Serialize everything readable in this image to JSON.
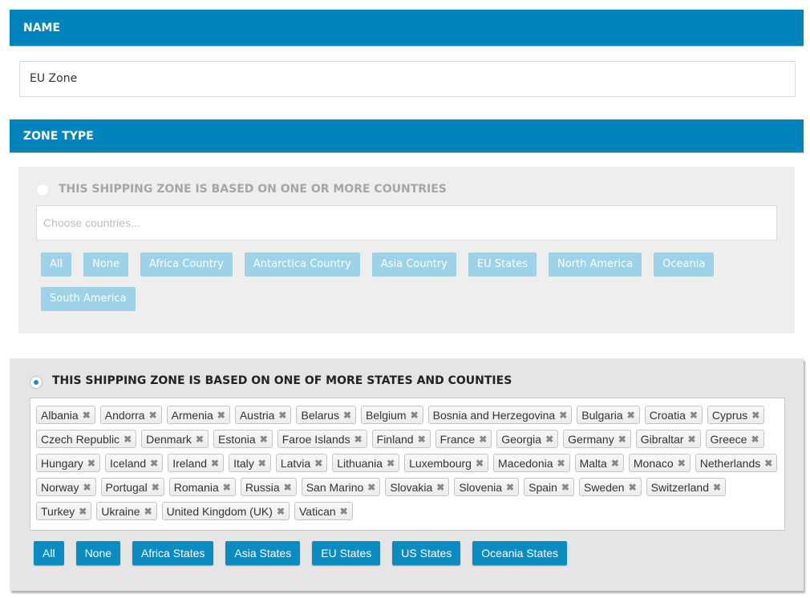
{
  "name_section": {
    "title": "NAME",
    "value": "EU Zone"
  },
  "zone_type_section": {
    "title": "ZONE TYPE"
  },
  "countries_option": {
    "label": "THIS SHIPPING ZONE IS BASED ON ONE OR MORE COUNTRIES",
    "selected": false,
    "placeholder": "Choose countries...",
    "buttons": [
      "All",
      "None",
      "Africa Country",
      "Antarctica Country",
      "Asia Country",
      "EU States",
      "North America",
      "Oceania",
      "South America"
    ]
  },
  "states_option": {
    "label": "THIS SHIPPING ZONE IS BASED ON ONE OF MORE STATES AND COUNTIES",
    "selected": true,
    "tags": [
      "Albania",
      "Andorra",
      "Armenia",
      "Austria",
      "Belarus",
      "Belgium",
      "Bosnia and Herzegovina",
      "Bulgaria",
      "Croatia",
      "Cyprus",
      "Czech Republic",
      "Denmark",
      "Estonia",
      "Faroe Islands",
      "Finland",
      "France",
      "Georgia",
      "Germany",
      "Gibraltar",
      "Greece",
      "Hungary",
      "Iceland",
      "Ireland",
      "Italy",
      "Latvia",
      "Lithuania",
      "Luxembourg",
      "Macedonia",
      "Malta",
      "Monaco",
      "Netherlands",
      "Norway",
      "Portugal",
      "Romania",
      "Russia",
      "San Marino",
      "Slovakia",
      "Slovenia",
      "Spain",
      "Sweden",
      "Switzerland",
      "Turkey",
      "Ukraine",
      "United Kingdom (UK)",
      "Vatican"
    ],
    "remove_glyph": "✖",
    "buttons": [
      "All",
      "None",
      "Africa States",
      "Asia States",
      "EU States",
      "US States",
      "Oceania States"
    ]
  }
}
